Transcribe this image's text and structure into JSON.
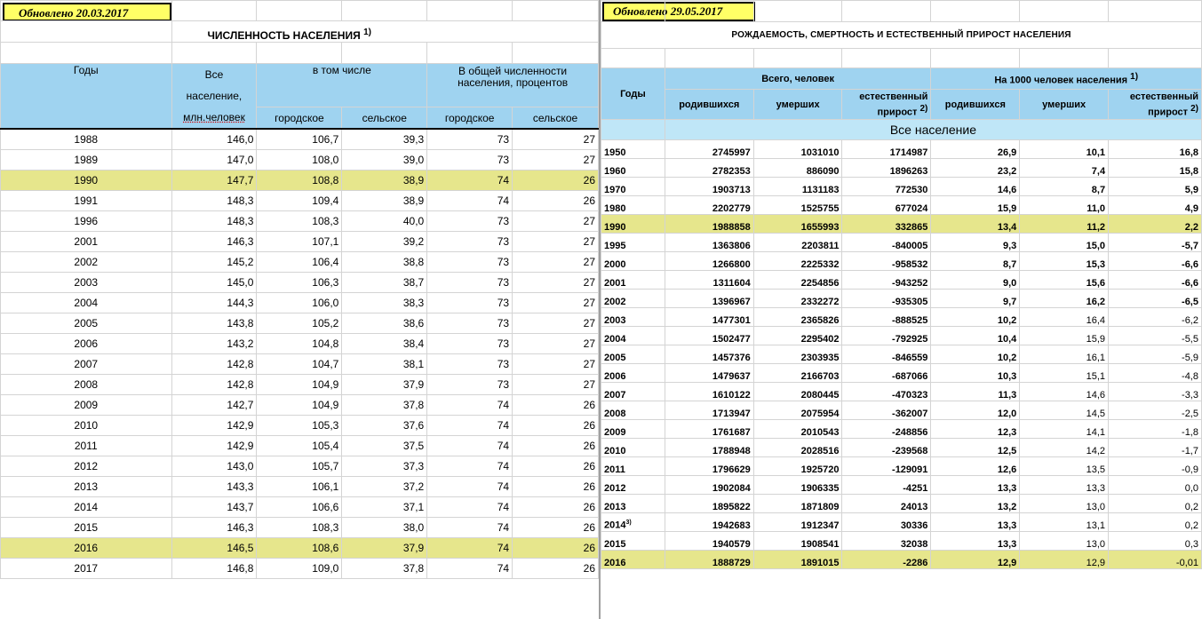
{
  "left": {
    "updated": "Обновлено 20.03.2017",
    "title": "ЧИСЛЕННОСТЬ НАСЕЛЕНИЯ",
    "title_note": "1)",
    "headers": {
      "years": "Годы",
      "all1": "Все",
      "all2": "население,",
      "all3": "млн.человек",
      "incl": "в том числе",
      "share": "В общей численности населения, процентов",
      "urban": "городское",
      "rural": "сельское",
      "urban2": "городское",
      "rural2": "сельское"
    },
    "rows": [
      [
        "1988",
        "146,0",
        "106,7",
        "39,3",
        "73",
        "27"
      ],
      [
        "1989",
        "147,0",
        "108,0",
        "39,0",
        "73",
        "27"
      ],
      [
        "1990",
        "147,7",
        "108,8",
        "38,9",
        "74",
        "26"
      ],
      [
        "1991",
        "148,3",
        "109,4",
        "38,9",
        "74",
        "26"
      ],
      [
        "1996",
        "148,3",
        "108,3",
        "40,0",
        "73",
        "27"
      ],
      [
        "2001",
        "146,3",
        "107,1",
        "39,2",
        "73",
        "27"
      ],
      [
        "2002",
        "145,2",
        "106,4",
        "38,8",
        "73",
        "27"
      ],
      [
        "2003",
        "145,0",
        "106,3",
        "38,7",
        "73",
        "27"
      ],
      [
        "2004",
        "144,3",
        "106,0",
        "38,3",
        "73",
        "27"
      ],
      [
        "2005",
        "143,8",
        "105,2",
        "38,6",
        "73",
        "27"
      ],
      [
        "2006",
        "143,2",
        "104,8",
        "38,4",
        "73",
        "27"
      ],
      [
        "2007",
        "142,8",
        "104,7",
        "38,1",
        "73",
        "27"
      ],
      [
        "2008",
        "142,8",
        "104,9",
        "37,9",
        "73",
        "27"
      ],
      [
        "2009",
        "142,7",
        "104,9",
        "37,8",
        "74",
        "26"
      ],
      [
        "2010",
        "142,9",
        "105,3",
        "37,6",
        "74",
        "26"
      ],
      [
        "2011",
        "142,9",
        "105,4",
        "37,5",
        "74",
        "26"
      ],
      [
        "2012",
        "143,0",
        "105,7",
        "37,3",
        "74",
        "26"
      ],
      [
        "2013",
        "143,3",
        "106,1",
        "37,2",
        "74",
        "26"
      ],
      [
        "2014",
        "143,7",
        "106,6",
        "37,1",
        "74",
        "26"
      ],
      [
        "2015",
        "146,3",
        "108,3",
        "38,0",
        "74",
        "26"
      ],
      [
        "2016",
        "146,5",
        "108,6",
        "37,9",
        "74",
        "26"
      ],
      [
        "2017",
        "146,8",
        "109,0",
        "37,8",
        "74",
        "26"
      ]
    ]
  },
  "right": {
    "updated": "Обновлено 29.05.2017",
    "title": "РОЖДАЕМОСТЬ, СМЕРТНОСТЬ И ЕСТЕСТВЕННЫЙ ПРИРОСТ НАСЕЛЕНИЯ",
    "headers": {
      "years": "Годы",
      "total": "Всего, человек",
      "per1000": "На 1000 человек населения",
      "per1000_note": "1)",
      "born": "родившихся",
      "died": "умерших",
      "nat1": "естественный",
      "nat2": "прирост",
      "nat_note": "2)",
      "born2": "родившихся",
      "died2": "умерших",
      "nat3": "естественный",
      "nat4": "прирост",
      "nat_note2": "2)"
    },
    "section": "Все население",
    "rows": [
      [
        "1950",
        "2745997",
        "1031010",
        "1714987",
        "26,9",
        "10,1",
        "16,8"
      ],
      [
        "1960",
        "2782353",
        "886090",
        "1896263",
        "23,2",
        "7,4",
        "15,8"
      ],
      [
        "1970",
        "1903713",
        "1131183",
        "772530",
        "14,6",
        "8,7",
        "5,9"
      ],
      [
        "1980",
        "2202779",
        "1525755",
        "677024",
        "15,9",
        "11,0",
        "4,9"
      ],
      [
        "1990",
        "1988858",
        "1655993",
        "332865",
        "13,4",
        "11,2",
        "2,2"
      ],
      [
        "1995",
        "1363806",
        "2203811",
        "-840005",
        "9,3",
        "15,0",
        "-5,7"
      ],
      [
        "2000",
        "1266800",
        "2225332",
        "-958532",
        "8,7",
        "15,3",
        "-6,6"
      ],
      [
        "2001",
        "1311604",
        "2254856",
        "-943252",
        "9,0",
        "15,6",
        "-6,6"
      ],
      [
        "2002",
        "1396967",
        "2332272",
        "-935305",
        "9,7",
        "16,2",
        "-6,5"
      ],
      [
        "2003",
        "1477301",
        "2365826",
        "-888525",
        "10,2",
        "16,4",
        "-6,2"
      ],
      [
        "2004",
        "1502477",
        "2295402",
        "-792925",
        "10,4",
        "15,9",
        "-5,5"
      ],
      [
        "2005",
        "1457376",
        "2303935",
        "-846559",
        "10,2",
        "16,1",
        "-5,9"
      ],
      [
        "2006",
        "1479637",
        "2166703",
        "-687066",
        "10,3",
        "15,1",
        "-4,8"
      ],
      [
        "2007",
        "1610122",
        "2080445",
        "-470323",
        "11,3",
        "14,6",
        "-3,3"
      ],
      [
        "2008",
        "1713947",
        "2075954",
        "-362007",
        "12,0",
        "14,5",
        "-2,5"
      ],
      [
        "2009",
        "1761687",
        "2010543",
        "-248856",
        "12,3",
        "14,1",
        "-1,8"
      ],
      [
        "2010",
        "1788948",
        "2028516",
        "-239568",
        "12,5",
        "14,2",
        "-1,7"
      ],
      [
        "2011",
        "1796629",
        "1925720",
        "-129091",
        "12,6",
        "13,5",
        "-0,9"
      ],
      [
        "2012",
        "1902084",
        "1906335",
        "-4251",
        "13,3",
        "13,3",
        "0,0"
      ],
      [
        "2013",
        "1895822",
        "1871809",
        "24013",
        "13,2",
        "13,0",
        "0,2"
      ],
      [
        "2014",
        "1942683",
        "1912347",
        "30336",
        "13,3",
        "13,1",
        "0,2"
      ],
      [
        "2015",
        "1940579",
        "1908541",
        "32038",
        "13,3",
        "13,0",
        "0,3"
      ],
      [
        "2016",
        "1888729",
        "1891015",
        "-2286",
        "12,9",
        "12,9",
        "-0,01"
      ]
    ],
    "year_2014_note": "3)"
  },
  "colors": {
    "header_blue": "#9fd3f0",
    "highlight": "#e6e68c",
    "updated_bg": "#ffff66"
  }
}
